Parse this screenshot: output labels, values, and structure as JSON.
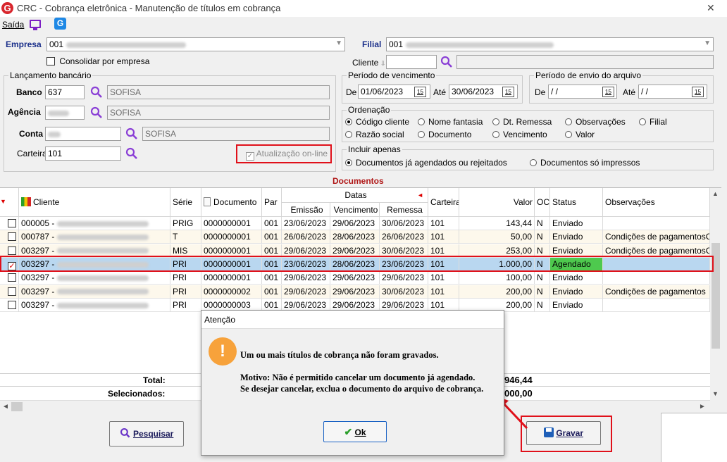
{
  "window": {
    "title": "CRC - Cobrança eletrônica - Manutenção de títulos em cobrança",
    "close": "✕"
  },
  "menu": {
    "saida": "Saída"
  },
  "empresa": {
    "label": "Empresa",
    "code": "001",
    "consolidar_label": "Consolidar por empresa"
  },
  "filial": {
    "label": "Filial",
    "code": "001"
  },
  "cliente": {
    "label": "Cliente"
  },
  "lancamento": {
    "title": "Lançamento bancário",
    "banco_label": "Banco",
    "banco_code": "637",
    "banco_name": "SOFISA",
    "agencia_label": "Agência",
    "agencia_name": "SOFISA",
    "conta_label": "Conta",
    "conta_name": "SOFISA",
    "carteira_label": "Carteira",
    "carteira_code": "101",
    "atualizacao_label": "Atualização on-line"
  },
  "vencimento": {
    "title": "Período de vencimento",
    "de_label": "De",
    "de": "01/06/2023",
    "ate_label": "Até",
    "ate": "30/06/2023",
    "cal": "15"
  },
  "envio": {
    "title": "Período de envio do arquivo",
    "de_label": "De",
    "de": " / /",
    "ate_label": "Até",
    "ate": " / /",
    "cal": "15"
  },
  "ordenacao": {
    "title": "Ordenação",
    "options": [
      "Código cliente",
      "Nome fantasia",
      "Dt. Remessa",
      "Observações",
      "Filial",
      "Razão social",
      "Documento",
      "Vencimento",
      "Valor"
    ],
    "selected": "Código cliente"
  },
  "incluir": {
    "title": "Incluir apenas",
    "opt1": "Documentos já agendados ou rejeitados",
    "opt2": "Documentos só impressos"
  },
  "documentos": {
    "title": "Documentos"
  },
  "grid": {
    "headers": {
      "cliente": "Cliente",
      "serie": "Série",
      "documento": "Documento",
      "par": "Par",
      "datas": "Datas",
      "emissao": "Emissão",
      "vencimento": "Vencimento",
      "remessa": "Remessa",
      "carteira": "Carteira",
      "valor": "Valor",
      "oc": "OC",
      "status": "Status",
      "observacoes": "Observações"
    },
    "rows": [
      {
        "checked": false,
        "cliente": "000005 -",
        "serie": "PRIG",
        "documento": "0000000001",
        "par": "001",
        "emissao": "23/06/2023",
        "vencimento": "29/06/2023",
        "remessa": "30/06/2023",
        "carteira": "101",
        "valor": "143,44",
        "oc": "N",
        "status": "Enviado",
        "obs": ""
      },
      {
        "checked": false,
        "cliente": "000787 -",
        "serie": "T",
        "documento": "0000000001",
        "par": "001",
        "emissao": "26/06/2023",
        "vencimento": "28/06/2023",
        "remessa": "26/06/2023",
        "carteira": "101",
        "valor": "50,00",
        "oc": "N",
        "status": "Enviado",
        "obs": "Condições de pagamentosCc"
      },
      {
        "checked": false,
        "cliente": "003297 -",
        "serie": "MIS",
        "documento": "0000000001",
        "par": "001",
        "emissao": "29/06/2023",
        "vencimento": "29/06/2023",
        "remessa": "30/06/2023",
        "carteira": "101",
        "valor": "253,00",
        "oc": "N",
        "status": "Enviado",
        "obs": "Condições de pagamentosCc"
      },
      {
        "checked": true,
        "cliente": "003297 -",
        "serie": "PRI",
        "documento": "0000000001",
        "par": "001",
        "emissao": "23/06/2023",
        "vencimento": "28/06/2023",
        "remessa": "23/06/2023",
        "carteira": "101",
        "valor": "1.000,00",
        "oc": "N",
        "status": "Agendado",
        "obs": ""
      },
      {
        "checked": false,
        "cliente": "003297 -",
        "serie": "PRI",
        "documento": "0000000001",
        "par": "001",
        "emissao": "29/06/2023",
        "vencimento": "29/06/2023",
        "remessa": "29/06/2023",
        "carteira": "101",
        "valor": "100,00",
        "oc": "N",
        "status": "Enviado",
        "obs": ""
      },
      {
        "checked": false,
        "cliente": "003297 -",
        "serie": "PRI",
        "documento": "0000000002",
        "par": "001",
        "emissao": "29/06/2023",
        "vencimento": "29/06/2023",
        "remessa": "30/06/2023",
        "carteira": "101",
        "valor": "200,00",
        "oc": "N",
        "status": "Enviado",
        "obs": "Condições de pagamentos"
      },
      {
        "checked": false,
        "cliente": "003297 -",
        "serie": "PRI",
        "documento": "0000000003",
        "par": "001",
        "emissao": "29/06/2023",
        "vencimento": "29/06/2023",
        "remessa": "29/06/2023",
        "carteira": "101",
        "valor": "200,00",
        "oc": "N",
        "status": "Enviado",
        "obs": ""
      }
    ],
    "total_label": "Total:",
    "total_value": "946,44",
    "selecionados_label": "Selecionados:",
    "selecionados_value": "000,00"
  },
  "buttons": {
    "pesquisar": "Pesquisar",
    "gravar": "Gravar"
  },
  "dialog": {
    "title": "Atenção",
    "message1": "Um ou mais títulos de cobrança não foram gravados.",
    "message2": "Motivo: Não é permitido cancelar um documento já agendado.",
    "message3": "Se desejar cancelar, exclua o documento do arquivo de cobrança.",
    "ok": "Ok"
  },
  "colors": {
    "highlight": "#e0101a",
    "status_agendado": "#4ec94e",
    "selected_row": "#b9d7f0"
  }
}
